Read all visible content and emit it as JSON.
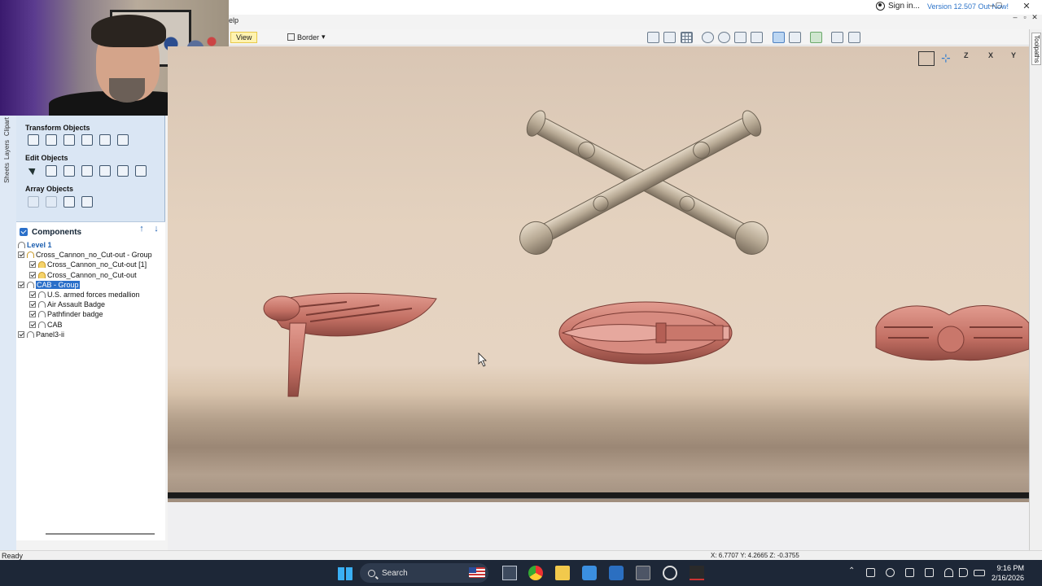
{
  "app": {
    "menu_help_fragment": "elp",
    "signin": "Sign in...",
    "version_link": "Version 12.507 Out Now!",
    "window_controls": {
      "minimize": "–",
      "maximize": "▢",
      "close": "✕"
    },
    "inner_controls": {
      "minimize": "–",
      "restore": "▫",
      "close": "✕"
    }
  },
  "toolbar": {
    "view_label": "View",
    "border_label": "Border",
    "border_caret": "▾",
    "icons": [
      "zoom-extents-icon",
      "zoom-window-icon",
      "grid-icon",
      "pan-icon",
      "zoom-icon",
      "zoom-in-icon",
      "zoom-out-icon",
      "render-icon",
      "shading-icon",
      "material-icon",
      "split-view-icon",
      "tile-view-icon"
    ]
  },
  "right_strip": {
    "toolpaths_tab": "Toolpaths"
  },
  "vertical_tabs": {
    "clipart": "Clipart",
    "layers": "Layers",
    "sheets": "Sheets"
  },
  "panel": {
    "transform_title": "Transform Objects",
    "edit_title": "Edit Objects",
    "array_title": "Array Objects",
    "components_title": "Components",
    "tree": [
      {
        "label": "Level 1",
        "type": "level",
        "indent": 0,
        "checked": false,
        "icon": "none"
      },
      {
        "label": "Cross_Cannon_no_Cut-out - Group",
        "type": "item",
        "indent": 0,
        "checked": true,
        "icon": "gold-plain"
      },
      {
        "label": "Cross_Cannon_no_Cut-out [1]",
        "type": "item",
        "indent": 1,
        "checked": true,
        "icon": "gold"
      },
      {
        "label": "Cross_Cannon_no_Cut-out",
        "type": "item",
        "indent": 1,
        "checked": true,
        "icon": "gold"
      },
      {
        "label": "CAB - Group",
        "type": "selected",
        "indent": 0,
        "checked": true,
        "icon": "plain"
      },
      {
        "label": "U.S. armed forces medallion",
        "type": "item",
        "indent": 1,
        "checked": true,
        "icon": "plain"
      },
      {
        "label": "Air Assault Badge",
        "type": "item",
        "indent": 1,
        "checked": true,
        "icon": "plain"
      },
      {
        "label": "Pathfinder badge",
        "type": "item",
        "indent": 1,
        "checked": true,
        "icon": "plain"
      },
      {
        "label": "CAB",
        "type": "item",
        "indent": 1,
        "checked": true,
        "icon": "plain"
      },
      {
        "label": "Panel3-ii",
        "type": "item",
        "indent": 0,
        "checked": true,
        "icon": "plain"
      }
    ]
  },
  "viewport": {
    "view_axes": [
      "Z",
      "X",
      "Y"
    ],
    "colors": {
      "selected_relief": "#c97a6e",
      "unselected_relief": "#c7b8a2",
      "wood": "#e4d2bf"
    }
  },
  "statusbar": {
    "ready": "Ready",
    "coords": "X: 6.7707 Y: 4.2665 Z: -0.3755"
  },
  "taskbar": {
    "search": "Search",
    "time": "9:16 PM",
    "date": "2/16/2026"
  }
}
